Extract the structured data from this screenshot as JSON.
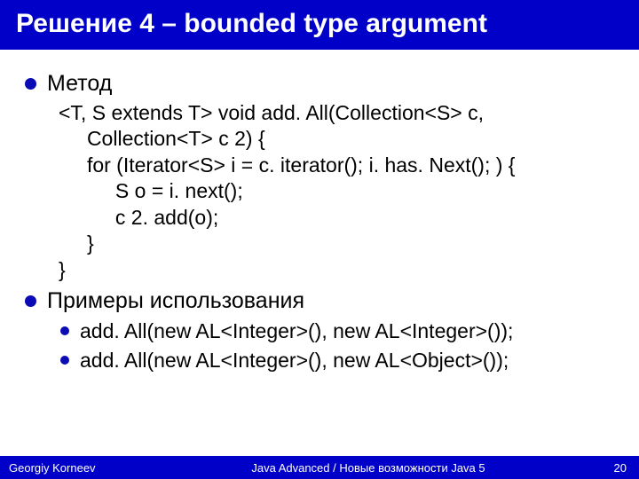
{
  "title": "Решение 4 – bounded type argument",
  "bullets": {
    "method_label": "Метод",
    "examples_label": "Примеры использования"
  },
  "code": {
    "l1": "<T, S extends T> void add. All(Collection<S> c,",
    "l2": "     Collection<T> c 2) {",
    "l3": "     for (Iterator<S> i = c. iterator(); i. has. Next(); ) {",
    "l4": "          S o = i. next();",
    "l5": "          c 2. add(o);",
    "l6": "     }",
    "l7": "}"
  },
  "examples": {
    "e1": "add. All(new AL<Integer>(), new AL<Integer>());",
    "e2": "add. All(new AL<Integer>(), new AL<Object>());"
  },
  "footer": {
    "author": "Georgiy Korneev",
    "course": "Java Advanced / Новые возможности Java 5",
    "page": "20"
  }
}
